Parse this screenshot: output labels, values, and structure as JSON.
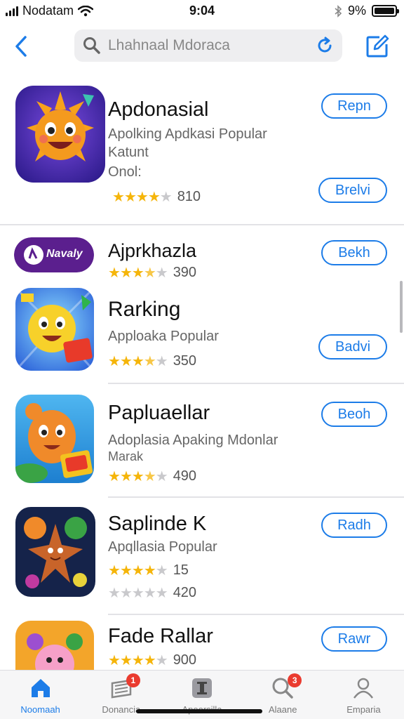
{
  "status_bar": {
    "carrier": "Nodatam",
    "time": "9:04",
    "battery": "9%"
  },
  "nav": {
    "search_placeholder": "Lhahnaal Mdoraca",
    "icons": [
      "back-chevron-icon",
      "search-icon",
      "refresh-icon",
      "compose-icon"
    ]
  },
  "apps": [
    {
      "name": "Apdonasial",
      "subtitle": "Apolking Apdkasi Popular",
      "subtitle2": "Katunt",
      "subtitle3": "Onol:",
      "stars": 4,
      "rating_count": "810",
      "button": "Repn",
      "button2": "Brelvi"
    },
    {
      "name": "Ajprkhazla",
      "banner_text": "Navaly",
      "stars": 3.5,
      "rating_count": "390",
      "button": "Bekh"
    },
    {
      "name": "Rarking",
      "subtitle": "Apploaka Popular",
      "stars": 3.5,
      "rating_count": "350",
      "button": "Badvi"
    },
    {
      "name": "Papluaellar",
      "subtitle": "Adoplasia Apaking Mdonlar",
      "subtitle2": "Marak",
      "stars": 3.5,
      "rating_count": "490",
      "button": "Beoh"
    },
    {
      "name": "Saplinde K",
      "subtitle": "Apqllasia Popular",
      "stars": 4,
      "rating_count": "15",
      "stars2": 0,
      "rating_count2": "420",
      "button": "Radh"
    },
    {
      "name": "Fade Rallar",
      "stars": 4,
      "rating_count": "900",
      "button": "Rawr"
    }
  ],
  "tabs": [
    {
      "label": "Noomaah",
      "icon": "home-icon",
      "active": true,
      "badge": ""
    },
    {
      "label": "Donancia",
      "icon": "stack-icon",
      "active": false,
      "badge": "1"
    },
    {
      "label": "Apoorsilla",
      "icon": "app-icon",
      "active": false,
      "badge": ""
    },
    {
      "label": "Alaane",
      "icon": "search-icon",
      "active": false,
      "badge": "3"
    },
    {
      "label": "Emparia",
      "icon": "person-icon",
      "active": false,
      "badge": ""
    }
  ],
  "colors": {
    "accent": "#1c7ce8",
    "star": "#f5b50a",
    "badge": "#ea3b2f"
  }
}
